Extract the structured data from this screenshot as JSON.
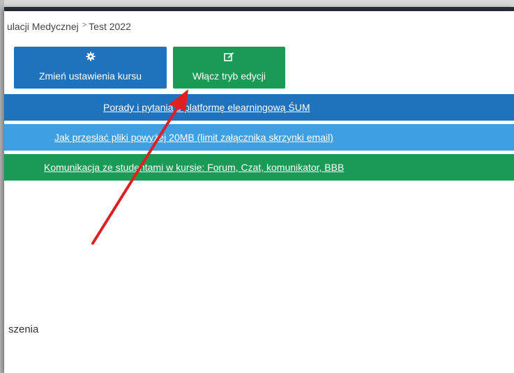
{
  "breadcrumb": {
    "items": [
      "ulacji Medycznej",
      "Test 2022"
    ],
    "separator": ">"
  },
  "buttons": {
    "settings": {
      "icon": "gear-icon",
      "label": "Zmień ustawienia kursu"
    },
    "edit": {
      "icon": "edit-icon",
      "label": "Włącz tryb edycji"
    }
  },
  "banners": [
    {
      "text": "Porady i pytania o platformę elearningową ŚUM",
      "color": "#1f72bc"
    },
    {
      "text": "Jak przesłać pliki powyżej 20MB (limit załącznika skrzynki email)",
      "color": "#3f9fe0"
    },
    {
      "text": "Komunikacja ze studentami w kursie: Forum, Czat, komunikator, BBB",
      "color": "#1a9a55"
    }
  ],
  "content": {
    "partial_text": "szenia"
  },
  "annotation": {
    "arrow_color": "#e02020"
  }
}
